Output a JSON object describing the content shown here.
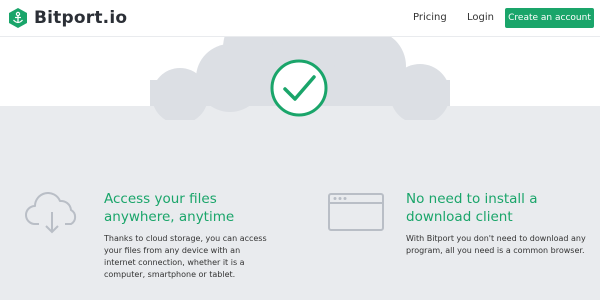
{
  "brand": {
    "name": "Bitport.io",
    "accent": "#1aa56a"
  },
  "nav": {
    "pricing_label": "Pricing",
    "login_label": "Login",
    "cta_label": "Create an account"
  },
  "hero": {
    "icon": "checkmark-circle-icon"
  },
  "features": [
    {
      "icon": "cloud-download-icon",
      "title_line1": "Access your files",
      "title_line2": "anywhere, anytime",
      "text": "Thanks to cloud storage, you can access your files from any device with an internet connection, whether it is a computer, smartphone or tablet."
    },
    {
      "icon": "browser-window-icon",
      "title_line1": "No need to install a",
      "title_line2": "download client",
      "text": "With Bitport you don't need to download any program, all you need is a common browser."
    }
  ],
  "colors": {
    "band": "#e9ebee",
    "cloud": "#dcdfe4",
    "icon_grey": "#b9bec6"
  }
}
